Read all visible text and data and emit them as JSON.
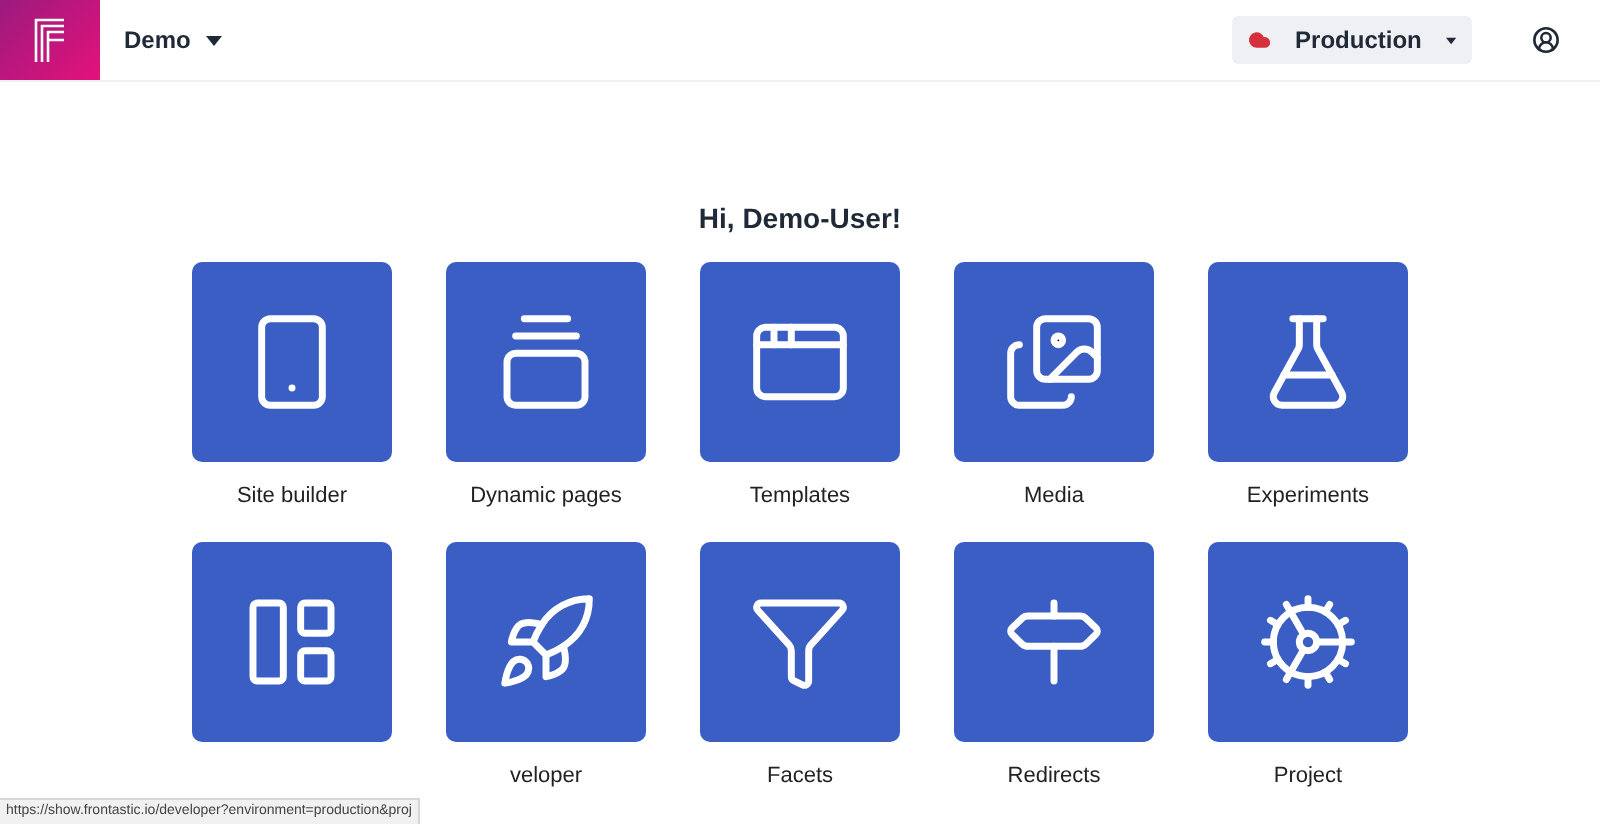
{
  "header": {
    "workspace": "Demo",
    "environment": "Production"
  },
  "greeting": "Hi, Demo-User!",
  "tiles": [
    {
      "kind": "labeled",
      "label": "Site builder"
    },
    {
      "kind": "labeled",
      "label": "Dynamic pages"
    },
    {
      "kind": "labeled",
      "label": "Templates"
    },
    {
      "kind": "labeled",
      "label": "Media"
    },
    {
      "kind": "labeled",
      "label": "Experiments"
    },
    {
      "kind": "unlabeled"
    },
    {
      "kind": "labeled",
      "label": "veloper"
    },
    {
      "kind": "labeled",
      "label": "Facets"
    },
    {
      "kind": "labeled",
      "label": "Redirects"
    },
    {
      "kind": "labeled",
      "label": "Project"
    }
  ],
  "status_bar": "https://show.frontastic.io/developer?environment=production&proj"
}
